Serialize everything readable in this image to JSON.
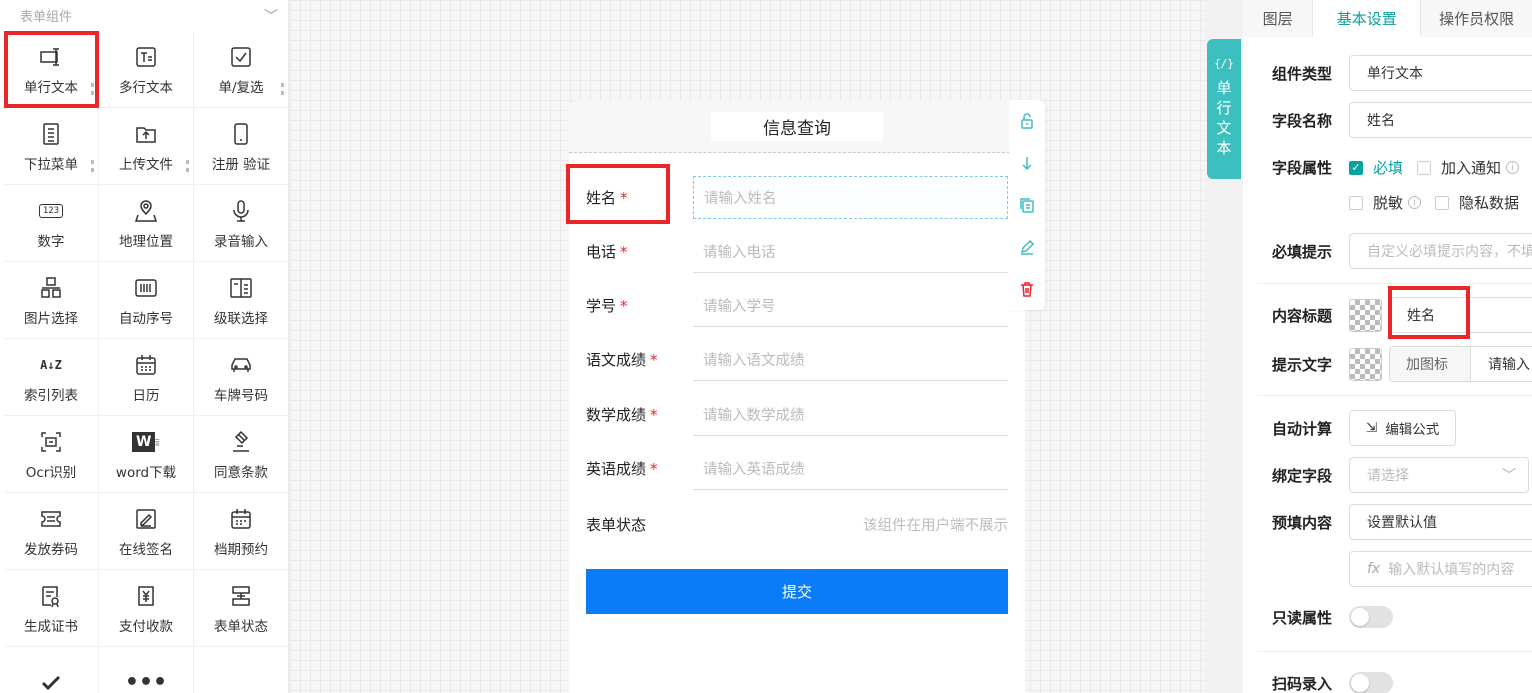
{
  "palette": {
    "header": "表单组件",
    "items": [
      {
        "label": "单行文本",
        "icon": "single-line-text-icon"
      },
      {
        "label": "多行文本",
        "icon": "multi-line-text-icon"
      },
      {
        "label": "单/复选",
        "icon": "checkbox-icon"
      },
      {
        "label": "下拉菜单",
        "icon": "dropdown-list-icon"
      },
      {
        "label": "上传文件",
        "icon": "upload-folder-icon"
      },
      {
        "label": "注册 验证",
        "icon": "phone-icon"
      },
      {
        "label": "数字",
        "icon": "number-123-icon",
        "glyph": "123"
      },
      {
        "label": "地理位置",
        "icon": "map-pin-icon"
      },
      {
        "label": "录音输入",
        "icon": "microphone-icon"
      },
      {
        "label": "图片选择",
        "icon": "image-grid-icon"
      },
      {
        "label": "自动序号",
        "icon": "barcode-icon"
      },
      {
        "label": "级联选择",
        "icon": "cascade-icon"
      },
      {
        "label": "索引列表",
        "icon": "sort-az-icon",
        "glyph": "A↓Z"
      },
      {
        "label": "日历",
        "icon": "calendar-icon"
      },
      {
        "label": "车牌号码",
        "icon": "car-icon"
      },
      {
        "label": "Ocr识别",
        "icon": "ocr-scan-icon"
      },
      {
        "label": "word下载",
        "icon": "word-icon",
        "glyph": "W"
      },
      {
        "label": "同意条款",
        "icon": "gavel-icon"
      },
      {
        "label": "发放券码",
        "icon": "coupon-icon"
      },
      {
        "label": "在线签名",
        "icon": "signature-icon"
      },
      {
        "label": "档期预约",
        "icon": "schedule-icon"
      },
      {
        "label": "生成证书",
        "icon": "certificate-icon"
      },
      {
        "label": "支付收款",
        "icon": "payment-yen-icon"
      },
      {
        "label": "表单状态",
        "icon": "form-status-icon"
      },
      {
        "label": "",
        "icon": "check-mark-icon"
      },
      {
        "label": "",
        "icon": "more-dots-icon"
      }
    ]
  },
  "form": {
    "title": "信息查询",
    "required_mark": "*",
    "fields": [
      {
        "label": "姓名",
        "placeholder": "请输入姓名"
      },
      {
        "label": "电话",
        "placeholder": "请输入电话"
      },
      {
        "label": "学号",
        "placeholder": "请输入学号"
      },
      {
        "label": "语文成绩",
        "placeholder": "请输入语文成绩"
      },
      {
        "label": "数学成绩",
        "placeholder": "请输入数学成绩"
      },
      {
        "label": "英语成绩",
        "placeholder": "请输入英语成绩"
      }
    ],
    "status_label": "表单状态",
    "status_hint": "该组件在用户端不展示",
    "submit": "提交"
  },
  "vertical_tag": {
    "code": "{/}",
    "chars": [
      "单",
      "行",
      "文",
      "本"
    ]
  },
  "panel": {
    "tabs": [
      "图层",
      "基本设置",
      "操作员权限"
    ],
    "active_tab": "基本设置",
    "component_type_label": "组件类型",
    "component_type_value": "单行文本",
    "field_name_label": "字段名称",
    "field_name_value": "姓名",
    "field_attr_label": "字段属性",
    "attr_required": "必填",
    "attr_notify": "加入通知",
    "attr_desensitize": "脱敏",
    "attr_privacy": "隐私数据",
    "required_hint_label": "必填提示",
    "required_hint_placeholder": "自定义必填提示内容，不填",
    "content_title_label": "内容标题",
    "content_title_value": "姓名",
    "hint_text_label": "提示文字",
    "add_icon_button": "加图标",
    "hint_text_value": "请输入",
    "auto_calc_label": "自动计算",
    "edit_formula_button": "编辑公式",
    "bind_field_label": "绑定字段",
    "bind_field_placeholder": "请选择",
    "prefill_label": "预填内容",
    "prefill_value": "设置默认值",
    "default_placeholder": "输入默认填写的内容",
    "readonly_label": "只读属性",
    "scan_label": "扫码录入",
    "accent_color": "#0aa2a0",
    "highlight_color": "#e8262b",
    "submit_color": "#0a7cf7"
  }
}
